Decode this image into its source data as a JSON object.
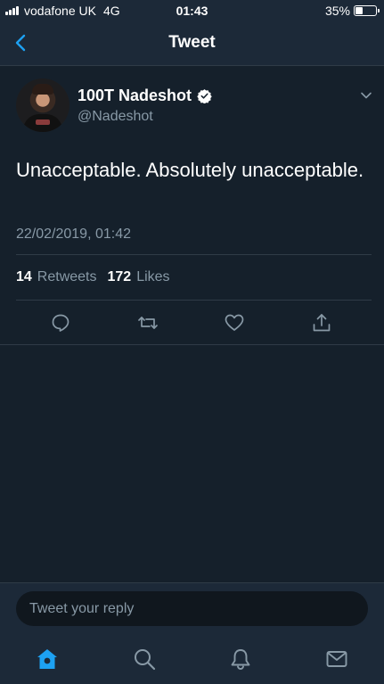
{
  "status_bar": {
    "carrier": "vodafone UK",
    "network": "4G",
    "time": "01:43",
    "battery_percent": "35%",
    "battery_level": 0.35
  },
  "nav": {
    "title": "Tweet",
    "back_icon": "chevron-left-icon"
  },
  "tweet": {
    "display_name": "100T Nadeshot",
    "handle": "@Nadeshot",
    "verified": true,
    "text": "Unacceptable. Absolutely unacceptable.",
    "timestamp": "22/02/2019, 01:42",
    "retweets_count": "14",
    "retweets_label": "Retweets",
    "likes_count": "172",
    "likes_label": "Likes"
  },
  "actions": [
    {
      "name": "reply",
      "icon": "reply-icon"
    },
    {
      "name": "retweet",
      "icon": "retweet-icon"
    },
    {
      "name": "like",
      "icon": "heart-icon"
    },
    {
      "name": "share",
      "icon": "share-icon"
    }
  ],
  "reply": {
    "placeholder": "Tweet your reply",
    "value": ""
  },
  "tab_bar": {
    "items": [
      {
        "name": "home",
        "icon": "home-icon",
        "active": true
      },
      {
        "name": "search",
        "icon": "search-icon",
        "active": false
      },
      {
        "name": "notifications",
        "icon": "bell-icon",
        "active": false
      },
      {
        "name": "messages",
        "icon": "mail-icon",
        "active": false
      }
    ]
  },
  "colors": {
    "background": "#15202b",
    "header_background": "#1c2938",
    "accent": "#1da1f2",
    "secondary_text": "#8899a6",
    "divider": "#2f3b47"
  }
}
